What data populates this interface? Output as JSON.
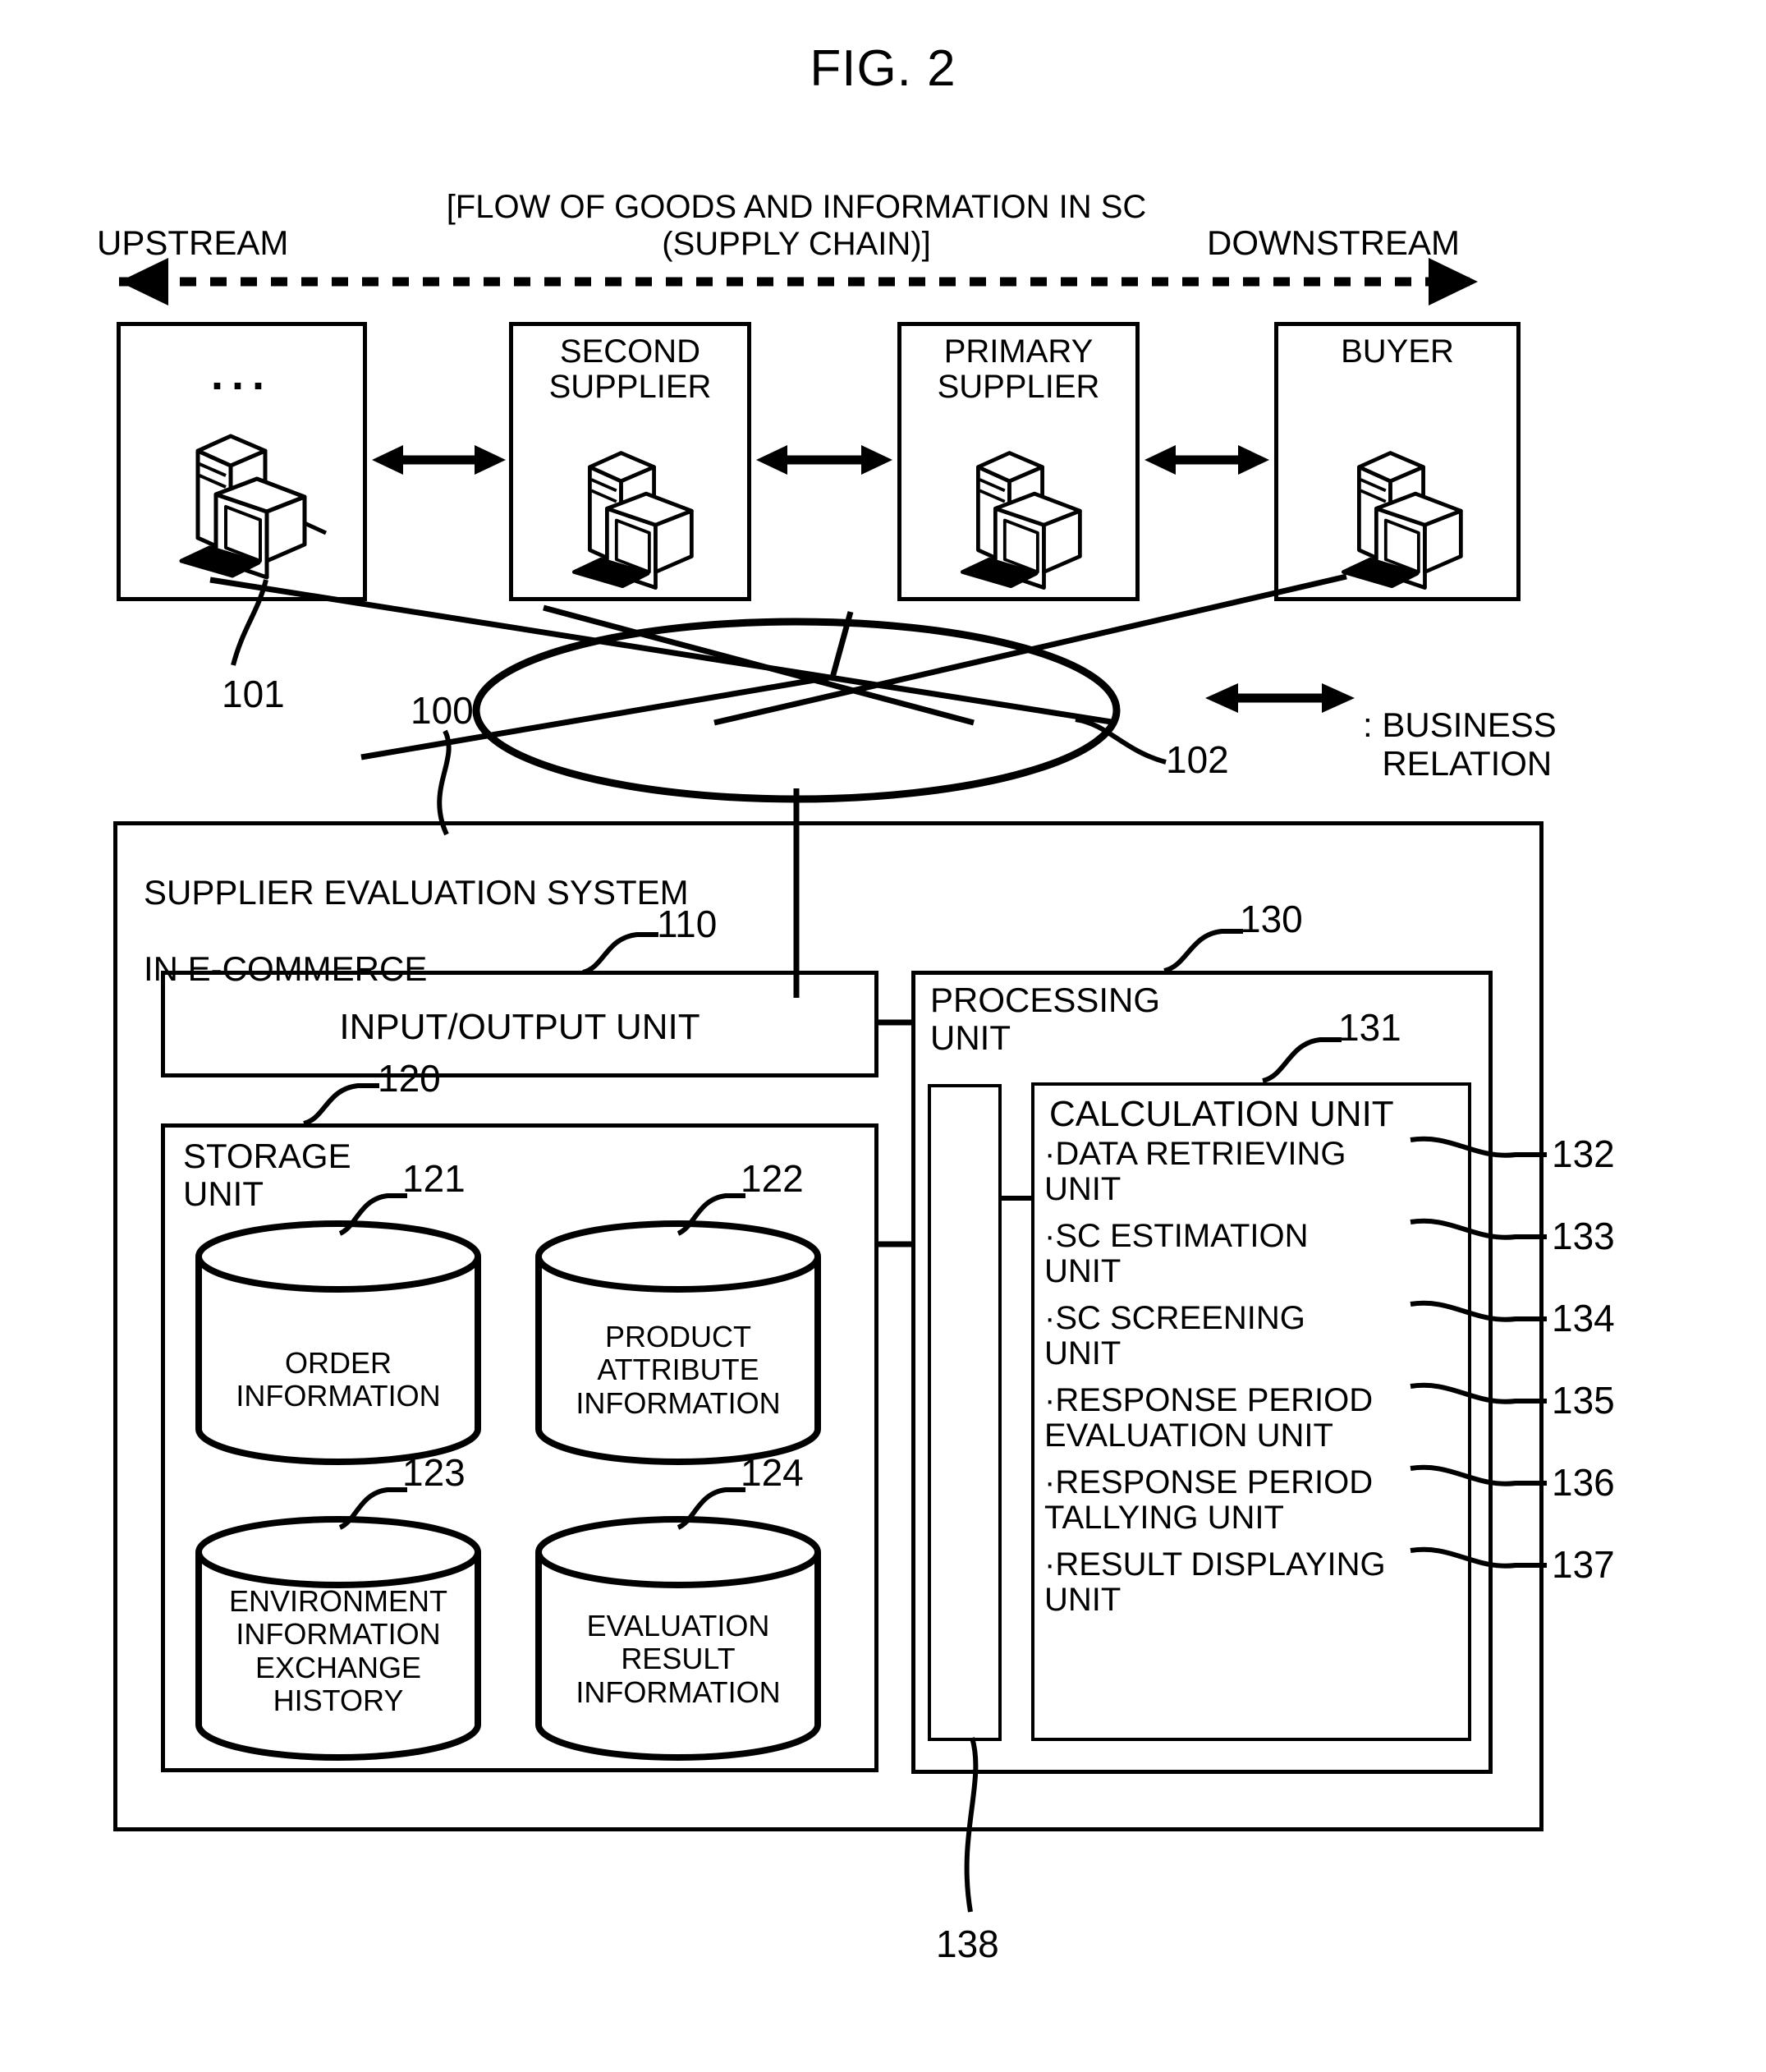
{
  "figure": {
    "title": "FIG. 2",
    "flow_caption_line1": "[FLOW OF GOODS AND INFORMATION IN SC",
    "flow_caption_line2": "(SUPPLY CHAIN)]",
    "upstream_label": "UPSTREAM",
    "downstream_label": "DOWNSTREAM"
  },
  "supply_chain": {
    "nodes": [
      {
        "label": "",
        "ellipsis": "...",
        "ref": "101"
      },
      {
        "label": "SECOND\nSUPPLIER",
        "ref": ""
      },
      {
        "label": "PRIMARY\nSUPPLIER",
        "ref": ""
      },
      {
        "label": "BUYER",
        "ref": ""
      }
    ],
    "network_ref": "102",
    "system_ref": "100",
    "legend": {
      "symbol_note": ":",
      "text": "BUSINESS\nRELATION"
    }
  },
  "system": {
    "title_line1": "SUPPLIER EVALUATION SYSTEM",
    "title_line2": "IN E-COMMERCE",
    "io_unit": {
      "label": "INPUT/OUTPUT UNIT",
      "ref": "110"
    },
    "storage_unit": {
      "label": "STORAGE\nUNIT",
      "ref": "120",
      "databases": [
        {
          "label": "ORDER\nINFORMATION",
          "ref": "121"
        },
        {
          "label": "PRODUCT\nATTRIBUTE\nINFORMATION",
          "ref": "122"
        },
        {
          "label": "ENVIRONMENT\nINFORMATION\nEXCHANGE\nHISTORY",
          "ref": "123"
        },
        {
          "label": "EVALUATION\nRESULT\nINFORMATION",
          "ref": "124"
        }
      ]
    },
    "processing_unit": {
      "label": "PROCESSING\nUNIT",
      "ref": "130",
      "bus_ref": "138",
      "calculation_unit": {
        "label": "CALCULATION UNIT",
        "ref": "131",
        "items": [
          {
            "text": "·DATA RETRIEVING\nUNIT",
            "ref": "132"
          },
          {
            "text": "·SC ESTIMATION\nUNIT",
            "ref": "133"
          },
          {
            "text": "·SC SCREENING\nUNIT",
            "ref": "134"
          },
          {
            "text": "·RESPONSE PERIOD\nEVALUATION UNIT",
            "ref": "135"
          },
          {
            "text": "·RESPONSE PERIOD\nTALLYING UNIT",
            "ref": "136"
          },
          {
            "text": "·RESULT DISPLAYING\nUNIT",
            "ref": "137"
          }
        ]
      }
    }
  },
  "colors": {
    "ink": "#000000",
    "paper": "#ffffff"
  }
}
